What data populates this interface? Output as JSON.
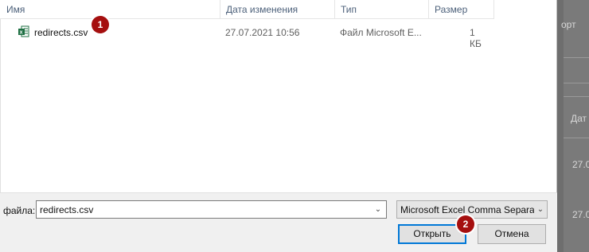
{
  "background_app": {
    "text_top": "орт",
    "text_mid": "Дат",
    "text_row1": "27.0",
    "text_row2": "27.0"
  },
  "columns": [
    {
      "label": "Имя"
    },
    {
      "label": "Дата изменения"
    },
    {
      "label": "Тип"
    },
    {
      "label": "Размер"
    }
  ],
  "file": {
    "name": "redirects.csv",
    "date": "27.07.2021 10:56",
    "type": "Файл Microsoft E...",
    "size": "1 КБ",
    "icon": "excel-file-icon"
  },
  "badges": {
    "one": "1",
    "two": "2"
  },
  "filename_field": {
    "label": "файла:",
    "value": "redirects.csv"
  },
  "filetype_select": {
    "value": "Microsoft Excel Comma Separa"
  },
  "buttons": {
    "open": "Открыть",
    "cancel": "Отмена"
  },
  "colors": {
    "badge": "#a50f0f",
    "focus": "#0078d7",
    "excel_green": "#1d6f42"
  }
}
